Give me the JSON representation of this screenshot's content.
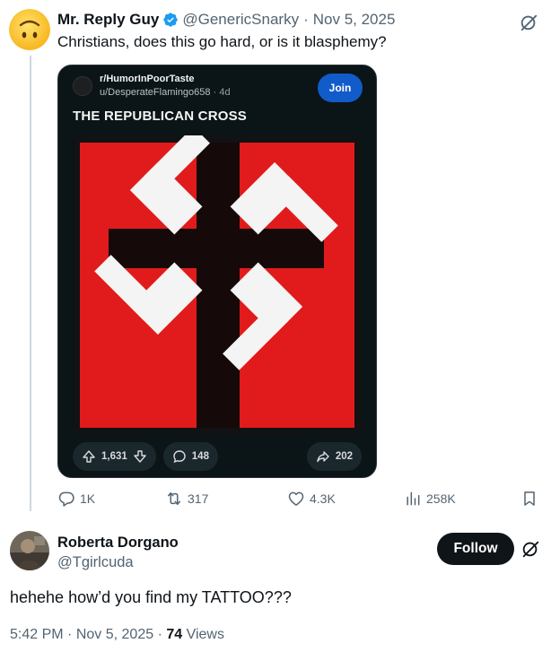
{
  "tweet": {
    "author_name": "Mr. Reply Guy",
    "author_handle": "@GenericSnarky",
    "separator": "·",
    "date": "Nov 5, 2025",
    "text": "Christians, does this go hard, or is it blasphemy?",
    "avatar_icon": "upside-down-face-emoji",
    "verified_color": "#1d9bf0"
  },
  "embed": {
    "subreddit": "r/HumorInPoorTaste",
    "user": "u/DesperateFlamingo658",
    "time": "4d",
    "join_label": "Join",
    "title": "THE REPUBLICAN CROSS",
    "upvotes": "1,631",
    "comments": "148",
    "shares": "202",
    "colors": {
      "join": "#115bca",
      "flag_red": "#e11b1b",
      "cross": "#150909",
      "arms": "#f4f4f4"
    }
  },
  "actions": {
    "replies": "1K",
    "reposts": "317",
    "likes": "4.3K",
    "views": "258K"
  },
  "reply": {
    "author_name": "Roberta Dorgano",
    "author_handle": "@Tgirlcuda",
    "follow_label": "Follow",
    "text": "hehehe how’d you find my TATTOO???",
    "time": "5:42 PM",
    "separator": "·",
    "date": "Nov 5, 2025",
    "views_count": "74",
    "views_label": "Views"
  }
}
